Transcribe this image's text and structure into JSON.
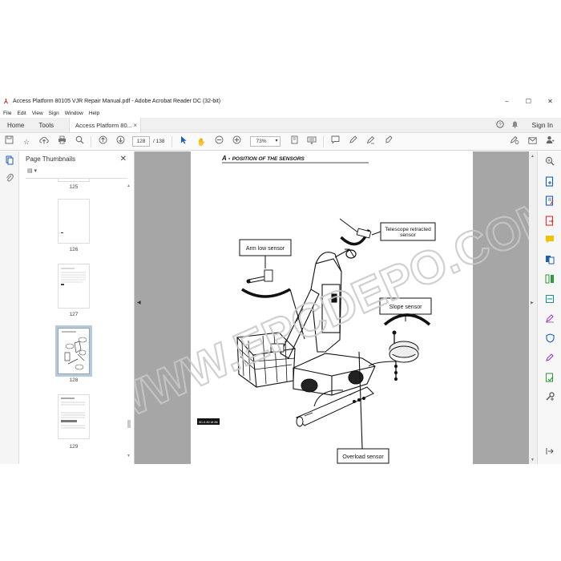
{
  "window": {
    "title": "Access Platform 80105 VJR Repair Manual.pdf - Adobe Acrobat Reader DC (32-bit)",
    "controls": {
      "minimize": "–",
      "maximize": "☐",
      "close": "✕"
    }
  },
  "menu": [
    "File",
    "Edit",
    "View",
    "Sign",
    "Window",
    "Help"
  ],
  "tabs": {
    "home": "Home",
    "tools": "Tools",
    "document": "Access Platform 80...",
    "close": "×",
    "sign_in": "Sign In"
  },
  "toolbar": {
    "current_page": "128",
    "total_pages": "/ 138",
    "zoom": "73%"
  },
  "thumbnail_panel": {
    "title": "Page Thumbnails",
    "close": "✕",
    "options": "▤ ▾",
    "pages": [
      "125",
      "126",
      "127",
      "128",
      "129"
    ],
    "selected_page": "128"
  },
  "document": {
    "heading_prefix": "A - ",
    "heading": "Position of the sensors",
    "callouts": {
      "arm_low": "Arm low sensor",
      "telescope": "Telescope retracted sensor",
      "slope": "Slope sensor",
      "overload": "Overload sensor"
    },
    "figure_ref": "80-0.80.M.86"
  },
  "watermark": "WWW.EPCDEPO.COM",
  "colors": {
    "accent": "#1a5fb4",
    "doc_background": "#a6a6a6",
    "acrobat_red": "#d81b1b"
  }
}
